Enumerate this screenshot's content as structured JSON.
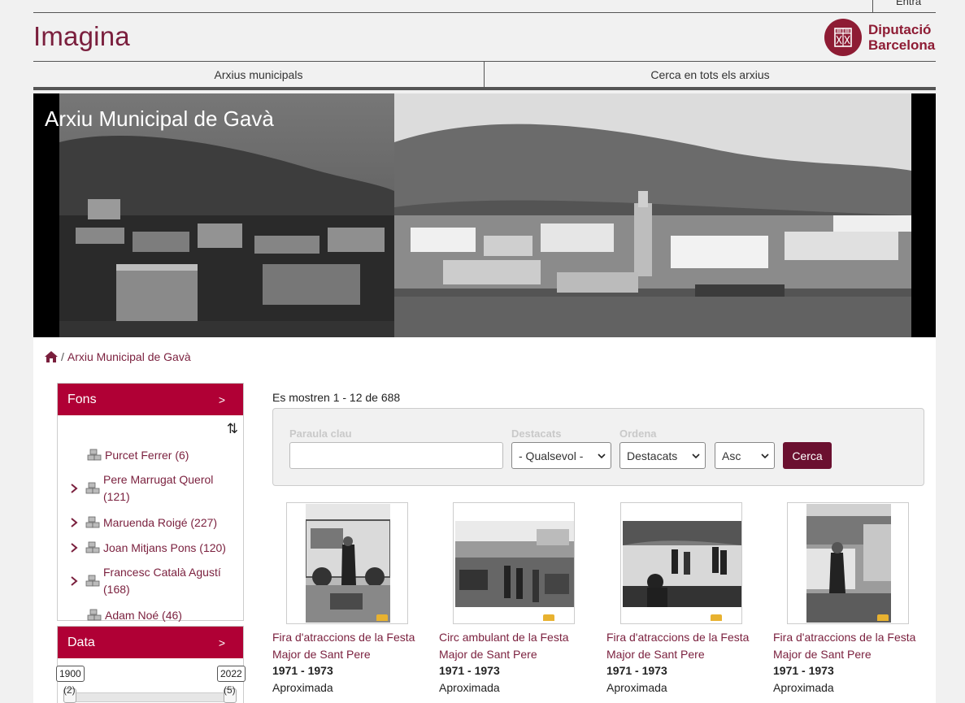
{
  "top": {
    "tab_label": "Entra"
  },
  "brand": {
    "name": "Imagina"
  },
  "logo": {
    "line1": "Diputació",
    "line2": "Barcelona"
  },
  "nav": [
    {
      "label": "Arxius municipals"
    },
    {
      "label": "Cerca en tots els arxius"
    }
  ],
  "hero": {
    "title": "Arxiu Municipal de Gavà"
  },
  "breadcrumb": {
    "separator": "/",
    "current": "Arxiu Municipal de Gavà"
  },
  "sidebar": {
    "fons": {
      "title": "Fons",
      "chevron": ">",
      "sort_glyph": "⇅",
      "items": [
        {
          "label": "Purcet Ferrer (6)",
          "expandable": false
        },
        {
          "label": "Pere Marrugat Querol (121)",
          "expandable": true
        },
        {
          "label": "Maruenda Roigé (227)",
          "expandable": true
        },
        {
          "label": "Joan Mitjans Pons (120)",
          "expandable": true
        },
        {
          "label": "Francesc Català Agustí (168)",
          "expandable": true
        },
        {
          "label": "Adam Noé (46)",
          "expandable": false
        }
      ]
    },
    "data": {
      "title": "Data",
      "chevron": ">",
      "slider": {
        "min_label": "1900",
        "max_label": "2022",
        "min_count": "(2)",
        "max_count": "(5)"
      }
    }
  },
  "results": {
    "summary": "Es mostren 1 - 12 de 688"
  },
  "search": {
    "keyword_label": "Paraula clau",
    "keyword_value": "",
    "destacats_label": "Destacats",
    "destacats_value": "- Qualsevol -",
    "ordena_label": "Ordena",
    "ordena_value": "Destacats",
    "direction_value": "Asc",
    "button_label": "Cerca"
  },
  "cards": [
    {
      "title": "Fira d'atraccions de la Festa Major de Sant Pere",
      "date": "1971 - 1973",
      "approx": "Aproximada"
    },
    {
      "title": "Circ ambulant de la Festa Major de Sant Pere",
      "date": "1971 - 1973",
      "approx": "Aproximada"
    },
    {
      "title": "Fira d'atraccions de la Festa Major de Sant Pere",
      "date": "1971 - 1973",
      "approx": "Aproximada"
    },
    {
      "title": "Fira d'atraccions de la Festa Major de Sant Pere",
      "date": "1971 - 1973",
      "approx": "Aproximada"
    }
  ],
  "colors": {
    "brand": "#7a1f3d",
    "panel_header": "#b00035",
    "button": "#6b1030",
    "logo": "#8e1c34"
  }
}
